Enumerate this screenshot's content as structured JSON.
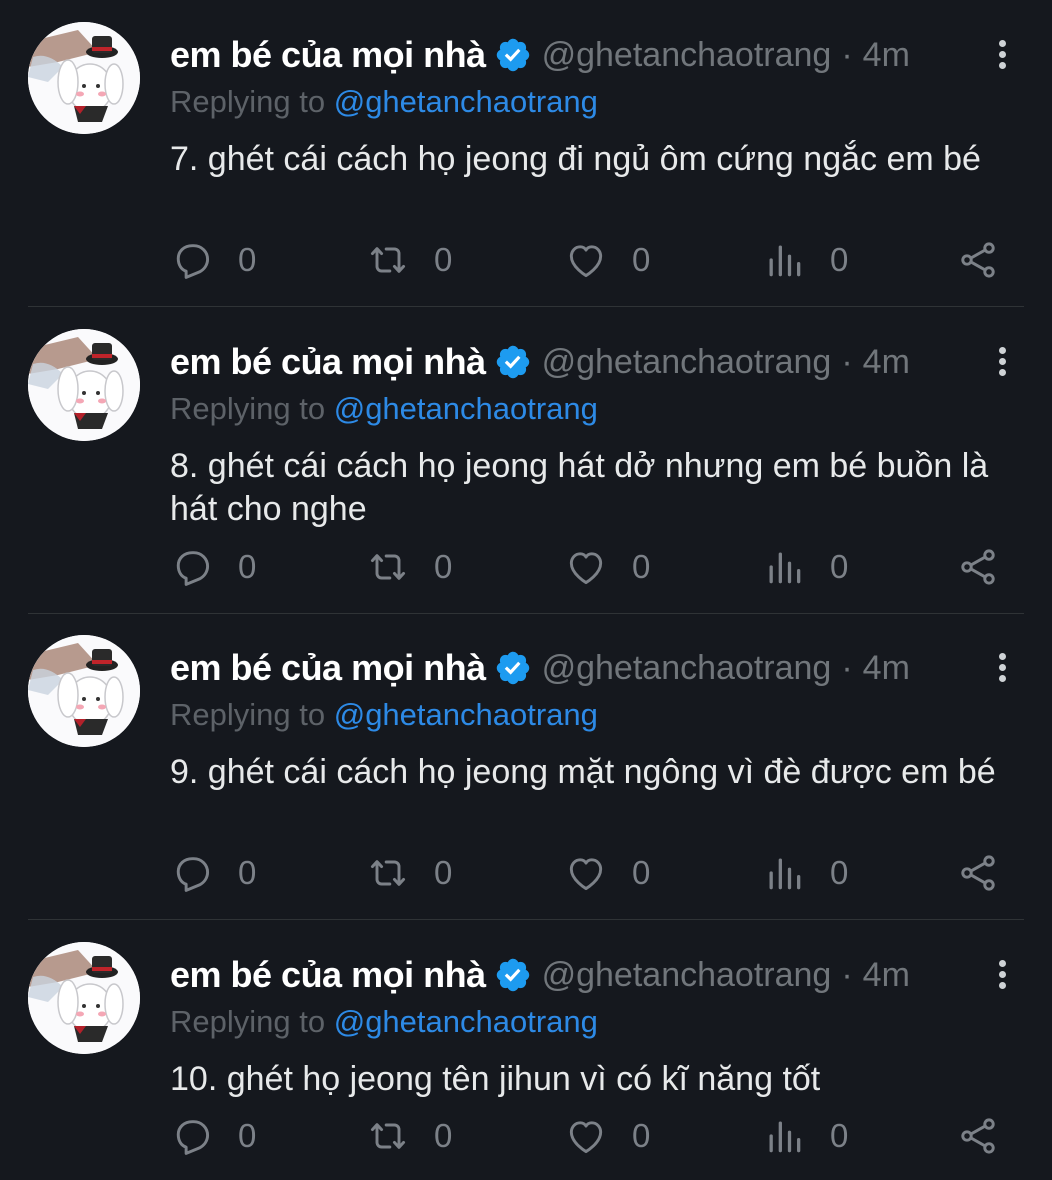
{
  "colors": {
    "background": "#15181e",
    "verified": "#1d9bf0",
    "mention": "#2d8ae6",
    "muted": "#71767b"
  },
  "tweets": [
    {
      "display_name": "em bé của mọi nhà",
      "handle": "@ghetanchaotrang",
      "dot": "·",
      "time": "4m",
      "replying_label": "Replying to",
      "replying_to": "@ghetanchaotrang",
      "text": "7. ghét cái cách họ jeong đi ngủ ôm cứng ngắc em bé",
      "replies": "0",
      "retweets": "0",
      "likes": "0",
      "views": "0"
    },
    {
      "display_name": "em bé của mọi nhà",
      "handle": "@ghetanchaotrang",
      "dot": "·",
      "time": "4m",
      "replying_label": "Replying to",
      "replying_to": "@ghetanchaotrang",
      "text": "8. ghét cái cách họ jeong hát dở nhưng em bé buồn là hát cho nghe",
      "replies": "0",
      "retweets": "0",
      "likes": "0",
      "views": "0"
    },
    {
      "display_name": "em bé của mọi nhà",
      "handle": "@ghetanchaotrang",
      "dot": "·",
      "time": "4m",
      "replying_label": "Replying to",
      "replying_to": "@ghetanchaotrang",
      "text": "9. ghét cái cách họ jeong mặt ngông vì đè được em bé",
      "replies": "0",
      "retweets": "0",
      "likes": "0",
      "views": "0"
    },
    {
      "display_name": "em bé của mọi nhà",
      "handle": "@ghetanchaotrang",
      "dot": "·",
      "time": "4m",
      "replying_label": "Replying to",
      "replying_to": "@ghetanchaotrang",
      "text": "10. ghét họ jeong tên jihun vì có kĩ năng tốt",
      "replies": "0",
      "retweets": "0",
      "likes": "0",
      "views": "0"
    }
  ],
  "icons": {
    "verified": "verified-badge-icon",
    "more": "more-vertical-icon",
    "reply": "reply-icon",
    "retweet": "retweet-icon",
    "like": "heart-icon",
    "views": "views-icon",
    "share": "share-icon",
    "avatar": "bunny-top-hat-avatar"
  }
}
